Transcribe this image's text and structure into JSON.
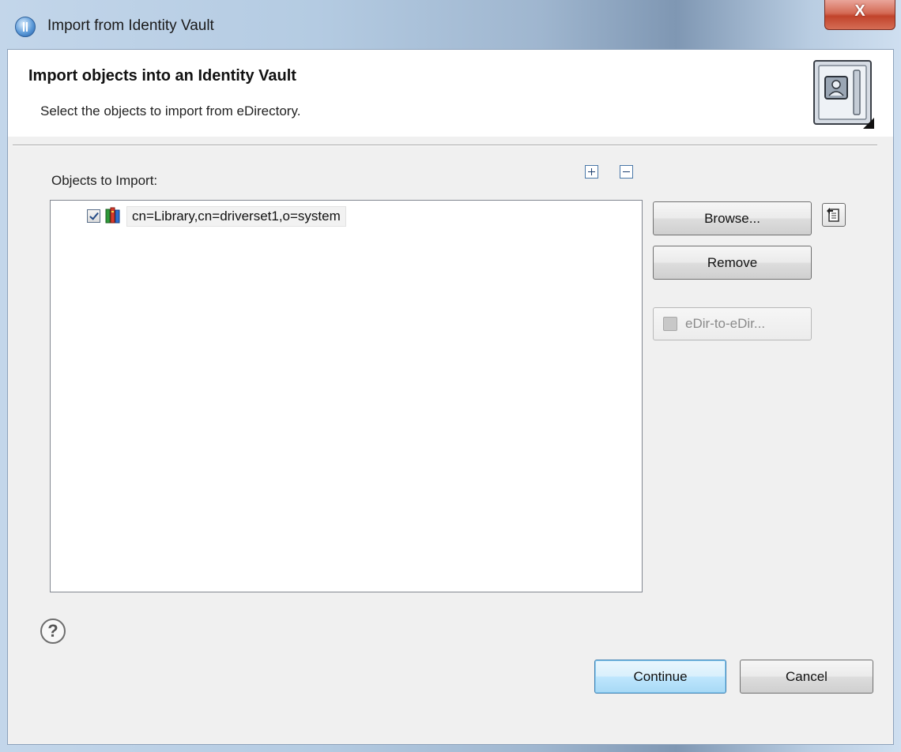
{
  "window": {
    "title": "Import from Identity Vault",
    "close_label": "X"
  },
  "banner": {
    "title": "Import objects into an Identity Vault",
    "description": "Select the objects to import from eDirectory."
  },
  "objects": {
    "label": "Objects to Import:",
    "items": [
      {
        "label": "cn=Library,cn=driverset1,o=system",
        "checked": true
      }
    ]
  },
  "buttons": {
    "browse": "Browse...",
    "remove": "Remove",
    "edir": "eDir-to-eDir...",
    "continue": "Continue",
    "cancel": "Cancel"
  },
  "help": {
    "symbol": "?"
  },
  "icons": {
    "app": "identity-manager-icon",
    "banner": "vault-icon",
    "expand": "expand-all-icon",
    "collapse": "collapse-all-icon",
    "item": "books-icon",
    "browse_extra": "browse-dn-icon",
    "edir": "edir-icon",
    "help": "help-icon"
  }
}
